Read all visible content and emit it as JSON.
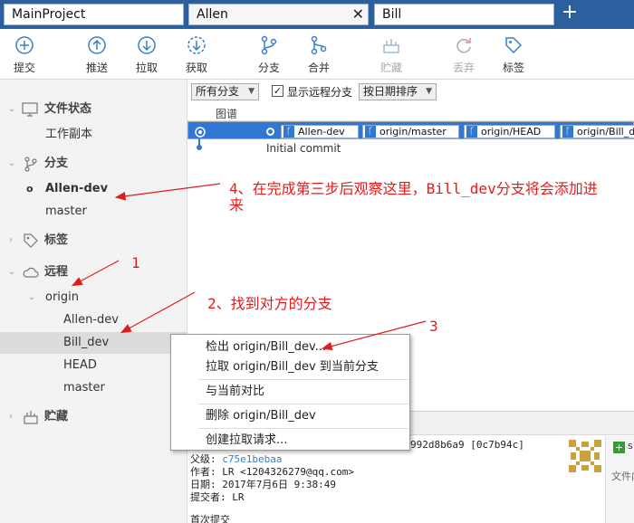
{
  "tabs": [
    {
      "label": "MainProject"
    },
    {
      "label": "Allen",
      "close": "✕"
    },
    {
      "label": "Bill"
    }
  ],
  "tab_add": "+",
  "toolbar": {
    "commit": "提交",
    "push": "推送",
    "pull": "拉取",
    "fetch": "获取",
    "branch": "分支",
    "merge": "合并",
    "stash": "贮藏",
    "discard": "丢弃",
    "tag": "标签"
  },
  "sidebar": {
    "workspace": "文件状态",
    "working_copy": "工作副本",
    "branches": "分支",
    "branch_items": [
      "Allen-dev",
      "master"
    ],
    "tags": "标签",
    "remotes": "远程",
    "origin": "origin",
    "remote_items": [
      "Allen-dev",
      "Bill_dev",
      "HEAD",
      "master"
    ],
    "stashes": "贮藏"
  },
  "filters": {
    "branch_select": "所有分支",
    "show_remote": "显示远程分支",
    "sort_select": "按日期排序",
    "check_mark": "✓"
  },
  "graph": {
    "header": "图谱",
    "row1_tags": [
      "Allen-dev",
      "origin/master",
      "origin/HEAD",
      "origin/Bill_d"
    ],
    "row2_message": "Initial commit"
  },
  "context_menu": {
    "items": [
      "检出 origin/Bill_dev...",
      "拉取 origin/Bill_dev 到当前分支",
      "与当前对比",
      "删除 origin/Bill_dev",
      "创建拉取请求..."
    ]
  },
  "details": {
    "hash_tail": "992d8b6a9 [0c7b94c]",
    "parent_label": "父级:",
    "parent_hash": "c75e1bebaa",
    "author": "作者: LR <1204326279@qq.com>",
    "date": "日期: 2017年7月6日 9:38:49",
    "committer": "提交者: LR",
    "message": "首次提交",
    "right_panel_label": "文件内",
    "right_panel_btn": "s"
  },
  "annotations": {
    "a1": "1",
    "a2": "2、找到对方的分支",
    "a3": "3",
    "a4_line1": "4、在完成第三步后观察这里，Bill_dev分支将会添加进",
    "a4_line2": "来"
  },
  "colors": {
    "tabbar": "#2b5f9e",
    "selection": "#2f78d6",
    "annotation": "#e21c1c"
  }
}
